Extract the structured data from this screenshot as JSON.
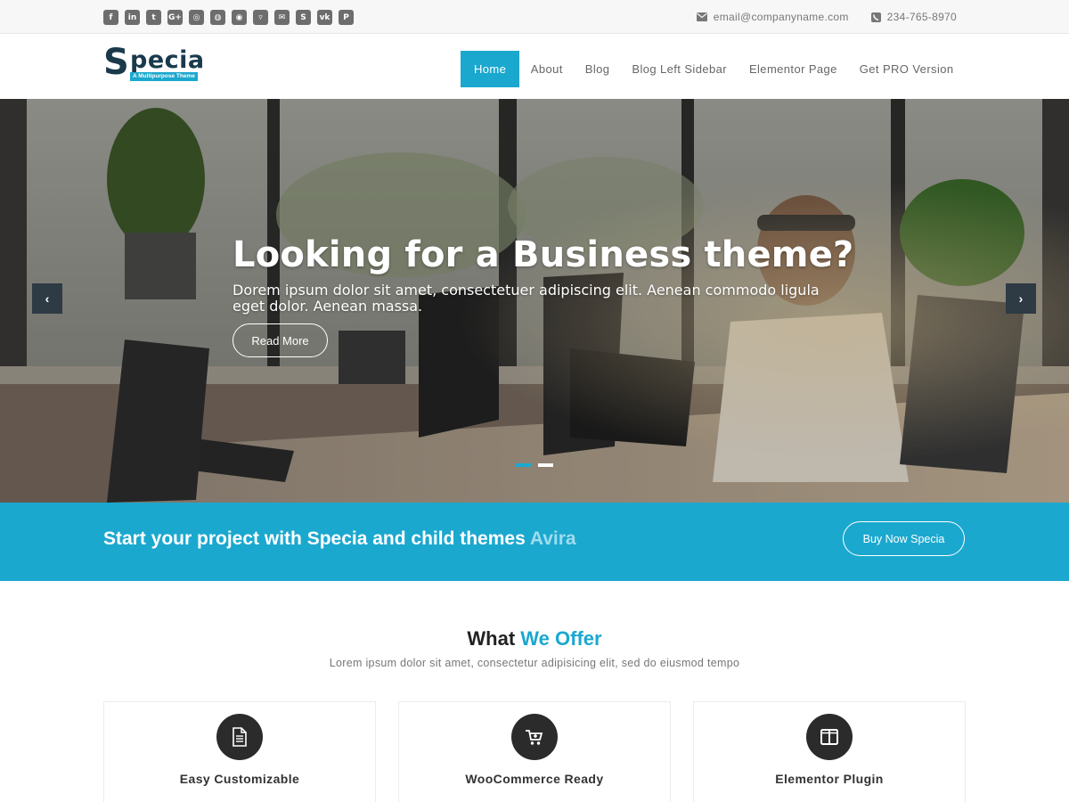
{
  "topbar": {
    "social_icons": [
      {
        "name": "facebook-icon",
        "glyph": "f"
      },
      {
        "name": "linkedin-icon",
        "glyph": "in"
      },
      {
        "name": "twitter-icon",
        "glyph": "t"
      },
      {
        "name": "google-plus-icon",
        "glyph": "G+"
      },
      {
        "name": "instagram-icon",
        "glyph": "◎"
      },
      {
        "name": "dribbble-icon",
        "glyph": "◍"
      },
      {
        "name": "github-icon",
        "glyph": "◉"
      },
      {
        "name": "bitbucket-icon",
        "glyph": "▿"
      },
      {
        "name": "email-icon",
        "glyph": "✉"
      },
      {
        "name": "skype-icon",
        "glyph": "S"
      },
      {
        "name": "vk-icon",
        "glyph": "vk"
      },
      {
        "name": "pinterest-icon",
        "glyph": "P"
      }
    ],
    "email": "email@companyname.com",
    "phone": "234-765-8970"
  },
  "header": {
    "logo_initial": "S",
    "logo_rest": "pecia",
    "logo_tagline": "A Multipurpose Theme",
    "nav": [
      {
        "label": "Home",
        "active": true
      },
      {
        "label": "About"
      },
      {
        "label": "Blog"
      },
      {
        "label": "Blog Left Sidebar"
      },
      {
        "label": "Elementor Page"
      },
      {
        "label": "Get PRO Version"
      }
    ]
  },
  "hero": {
    "title": "Looking for a Business theme?",
    "text": "Dorem ipsum dolor sit amet, consectetuer adipiscing elit. Aenean commodo ligula eget dolor. Aenean massa.",
    "button": "Read More",
    "prev_arrow": "‹",
    "next_arrow": "›",
    "slide_count": 2,
    "active_slide": 1
  },
  "cta": {
    "text": "Start your project with Specia and child themes",
    "accent": "Avira",
    "button": "Buy Now Specia"
  },
  "offer": {
    "title_plain": "What",
    "title_accent": "We Offer",
    "subtitle": "Lorem ipsum dolor sit amet, consectetur adipisicing elit, sed do eiusmod tempo",
    "cards": [
      {
        "label": "Easy Customizable",
        "icon": "document-icon"
      },
      {
        "label": "WooCommerce Ready",
        "icon": "cart-icon"
      },
      {
        "label": "Elementor Plugin",
        "icon": "columns-icon"
      }
    ]
  },
  "colors": {
    "accent": "#1ba8cf",
    "dark": "#2b2b2b",
    "topbar_bg": "#f7f7f7"
  }
}
